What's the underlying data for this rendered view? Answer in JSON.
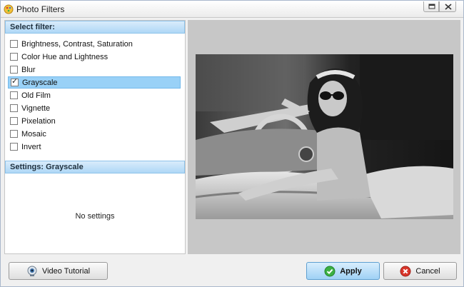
{
  "window": {
    "title": "Photo Filters"
  },
  "filters": {
    "header": "Select filter:",
    "items": [
      {
        "label": "Brightness, Contrast, Saturation",
        "checked": false
      },
      {
        "label": "Color Hue and Lightness",
        "checked": false
      },
      {
        "label": "Blur",
        "checked": false
      },
      {
        "label": "Grayscale",
        "checked": true
      },
      {
        "label": "Old Film",
        "checked": false
      },
      {
        "label": "Vignette",
        "checked": false
      },
      {
        "label": "Pixelation",
        "checked": false
      },
      {
        "label": "Mosaic",
        "checked": false
      },
      {
        "label": "Invert",
        "checked": false
      }
    ],
    "selected": "Grayscale"
  },
  "settings": {
    "header": "Settings: Grayscale",
    "message": "No settings"
  },
  "buttons": {
    "tutorial_label": "Video Tutorial",
    "apply_label": "Apply",
    "cancel_label": "Cancel"
  },
  "colors": {
    "accent": "#99d1f7",
    "header": "#aed7f6",
    "preview_bg": "#c7c7c7",
    "apply_icon": "#3cb043",
    "cancel_icon": "#d9362b"
  },
  "icons": {
    "app": "palette-icon",
    "tutorial": "webcam-icon",
    "apply": "check-circle-icon",
    "cancel": "x-circle-icon"
  }
}
